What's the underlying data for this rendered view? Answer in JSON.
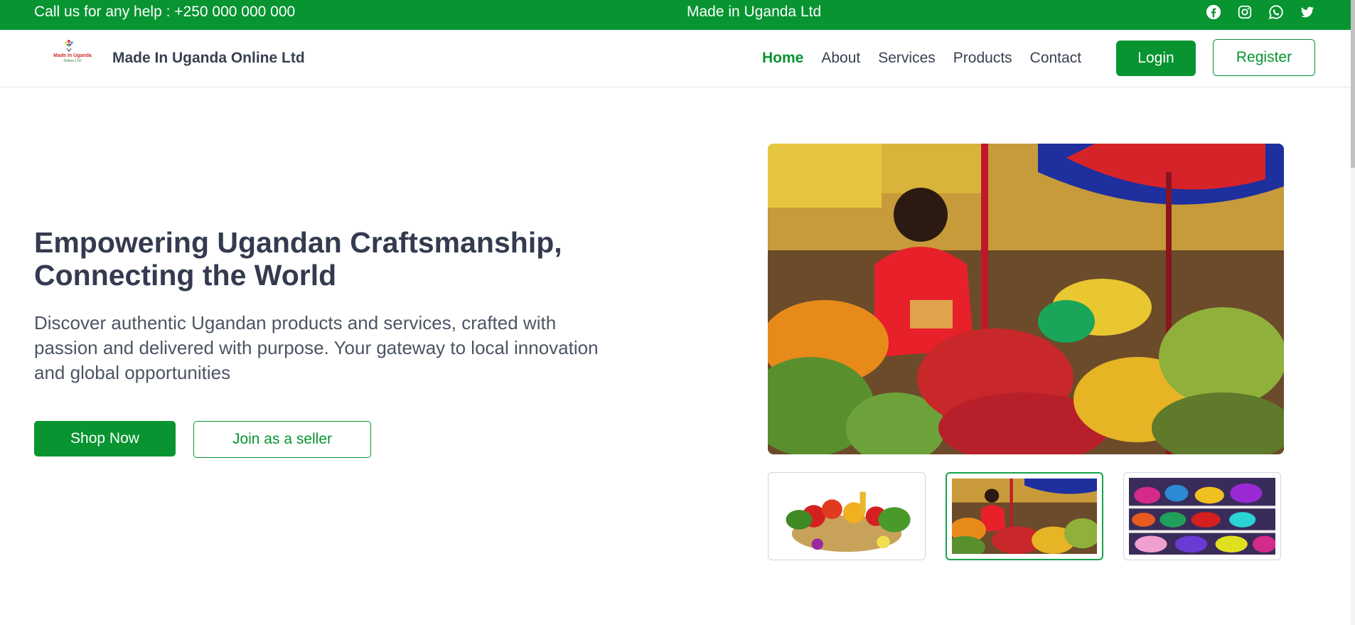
{
  "topbar": {
    "help_text": "Call us for any help : +250 000 000 000",
    "center_text": "Made in Uganda Ltd",
    "socials": [
      "facebook-icon",
      "instagram-icon",
      "whatsapp-icon",
      "twitter-icon"
    ]
  },
  "header": {
    "logo_text_1": "Made In Uganda",
    "logo_text_2": "Online LTD",
    "site_name": "Made In Uganda Online Ltd",
    "nav": [
      {
        "label": "Home",
        "active": true
      },
      {
        "label": "About",
        "active": false
      },
      {
        "label": "Services",
        "active": false
      },
      {
        "label": "Products",
        "active": false
      },
      {
        "label": "Contact",
        "active": false
      }
    ],
    "login_label": "Login",
    "register_label": "Register"
  },
  "hero": {
    "title_line1": "Empowering Ugandan Craftsmanship,",
    "title_line2": "Connecting the World",
    "subtitle": "Discover authentic Ugandan products and services, crafted with passion and delivered with purpose. Your gateway to local innovation and global opportunities",
    "shop_label": "Shop Now",
    "seller_label": "Join as a seller"
  },
  "gallery": {
    "main_image": "fruit-market-photo",
    "thumbnails": [
      {
        "image": "vegetable-basket-photo",
        "selected": false
      },
      {
        "image": "fruit-market-photo",
        "selected": true
      },
      {
        "image": "crafts-baskets-photo",
        "selected": false
      }
    ]
  },
  "colors": {
    "brand_green": "#079431",
    "text_dark": "#343a4f"
  }
}
